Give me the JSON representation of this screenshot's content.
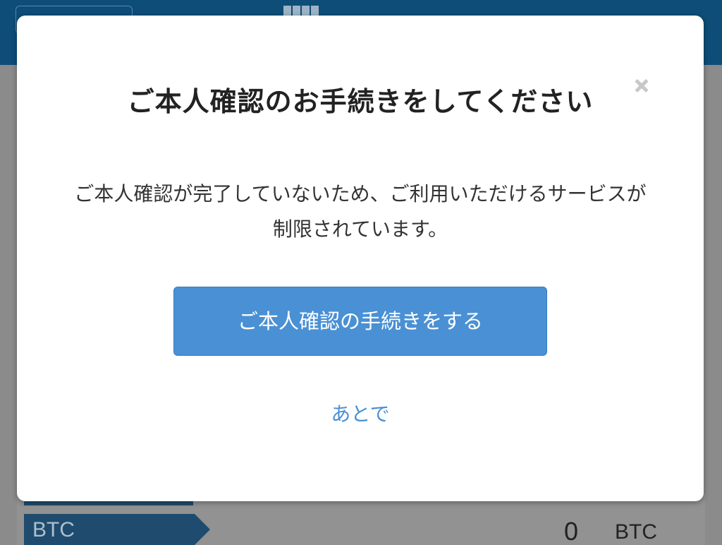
{
  "background": {
    "tab_label": "BTC",
    "balance_amount": "0",
    "balance_unit": "BTC"
  },
  "modal": {
    "title": "ご本人確認のお手続きをしてください",
    "close_icon": "close-icon",
    "message": "ご本人確認が完了していないため、ご利用いただけるサービスが制限されています。",
    "primary_button_label": "ご本人確認の手続きをする",
    "later_link_label": "あとで"
  },
  "colors": {
    "header": "#0d4d78",
    "overlay": "#8b8b8b",
    "primary": "#4a90d4",
    "tab": "#1f4b6e"
  }
}
